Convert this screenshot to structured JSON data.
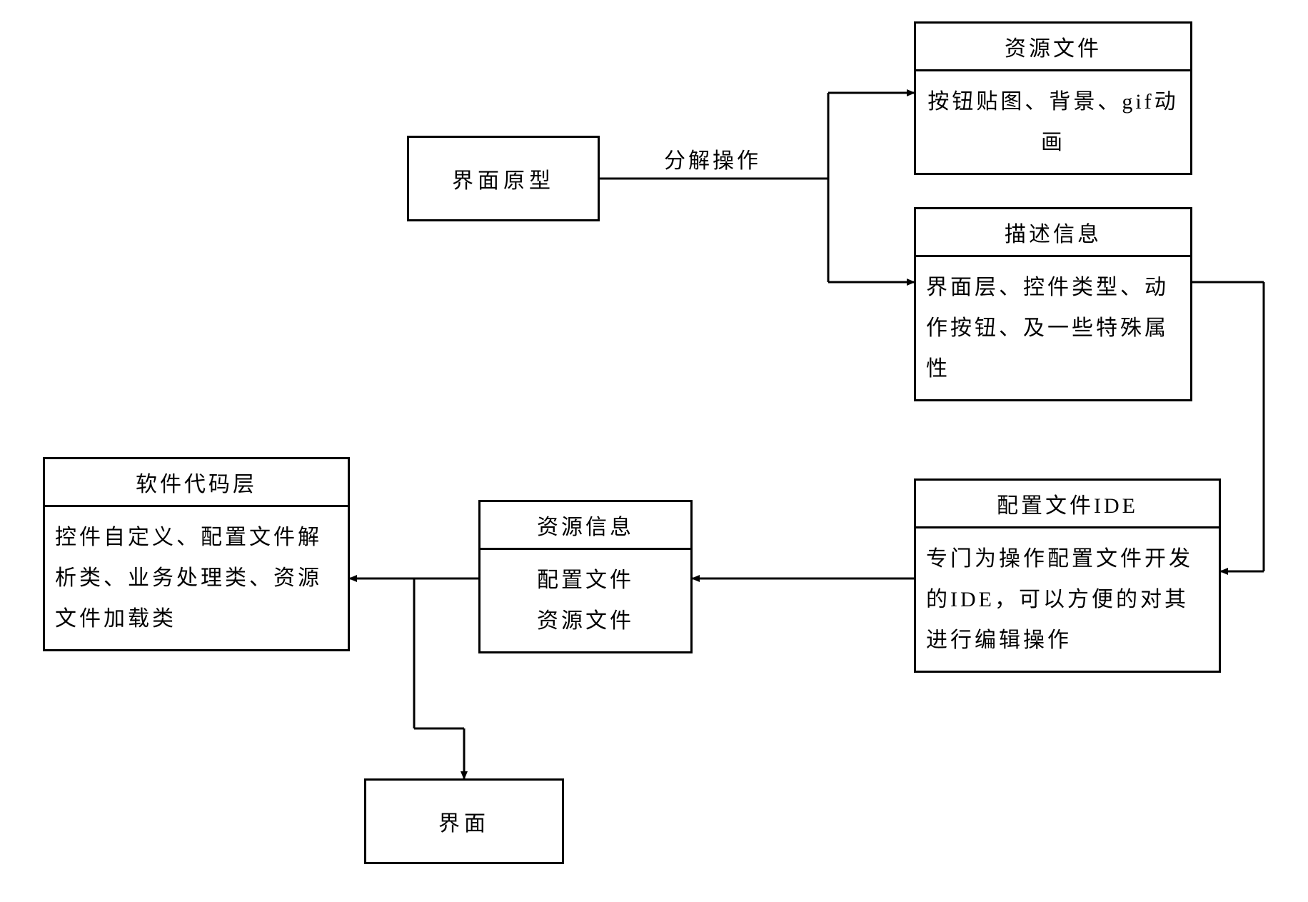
{
  "boxes": {
    "prototype": {
      "label": "界面原型"
    },
    "resource_file": {
      "title": "资源文件",
      "body": "按钮贴图、背景、gif动画"
    },
    "desc_info": {
      "title": "描述信息",
      "body": "界面层、控件类型、动作按钮、及一些特殊属性"
    },
    "config_ide": {
      "title": "配置文件IDE",
      "body": "专门为操作配置文件开发的IDE，可以方便的对其进行编辑操作"
    },
    "resource_info": {
      "title": "资源信息",
      "body_line1": "配置文件",
      "body_line2": "资源文件"
    },
    "code_layer": {
      "title": "软件代码层",
      "body": "控件自定义、配置文件解析类、业务处理类、资源文件加载类"
    },
    "interface": {
      "label": "界面"
    }
  },
  "edge_label": "分解操作"
}
